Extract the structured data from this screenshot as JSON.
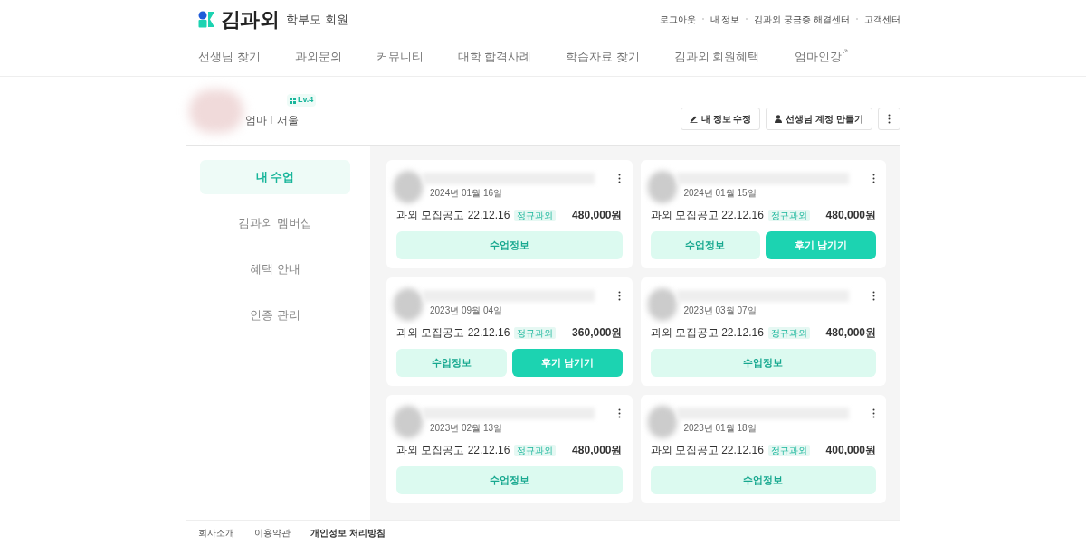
{
  "header": {
    "logo": "김과외",
    "member_type": "학부모 회원",
    "links": [
      "로그아웃",
      "내 정보",
      "김과외 궁금증 해결센터",
      "고객센터"
    ]
  },
  "nav": [
    {
      "label": "선생님 찾기",
      "external": false
    },
    {
      "label": "과외문의",
      "external": false
    },
    {
      "label": "커뮤니티",
      "external": false
    },
    {
      "label": "대학 합격사례",
      "external": false
    },
    {
      "label": "학습자료 찾기",
      "external": false
    },
    {
      "label": "김과외 회원혜택",
      "external": false
    },
    {
      "label": "엄마인강",
      "external": true
    }
  ],
  "profile": {
    "level": "Lv.4",
    "role": "엄마",
    "region": "서울",
    "buttons": [
      {
        "label": "내 정보 수정",
        "kind": "edit"
      },
      {
        "label": "선생님 계정 만들기",
        "kind": "person"
      }
    ]
  },
  "sidebar": [
    {
      "label": "내 수업",
      "selected": true
    },
    {
      "label": "김과외 멤버십",
      "selected": false
    },
    {
      "label": "혜택 안내",
      "selected": false
    },
    {
      "label": "인증 관리",
      "selected": false
    }
  ],
  "lessons": [
    {
      "date": "2024년 01월 16일",
      "post": "과외 모집공고 22.12.16",
      "tag": "정규과외",
      "price": "480,000원",
      "buttons": [
        "수업정보"
      ]
    },
    {
      "date": "2024년 01월 15일",
      "post": "과외 모집공고 22.12.16",
      "tag": "정규과외",
      "price": "480,000원",
      "buttons": [
        "수업정보",
        "후기 남기기"
      ]
    },
    {
      "date": "2023년 09월 04일",
      "post": "과외 모집공고 22.12.16",
      "tag": "정규과외",
      "price": "360,000원",
      "buttons": [
        "수업정보",
        "후기 남기기"
      ]
    },
    {
      "date": "2023년 03월 07일",
      "post": "과외 모집공고 22.12.16",
      "tag": "정규과외",
      "price": "480,000원",
      "buttons": [
        "수업정보"
      ]
    },
    {
      "date": "2023년 02월 13일",
      "post": "과외 모집공고 22.12.16",
      "tag": "정규과외",
      "price": "480,000원",
      "buttons": [
        "수업정보"
      ]
    },
    {
      "date": "2023년 01월 18일",
      "post": "과외 모집공고 22.12.16",
      "tag": "정규과외",
      "price": "400,000원",
      "buttons": [
        "수업정보"
      ]
    }
  ],
  "footer": [
    "회사소개",
    "이용약관",
    "개인정보 처리방침"
  ]
}
